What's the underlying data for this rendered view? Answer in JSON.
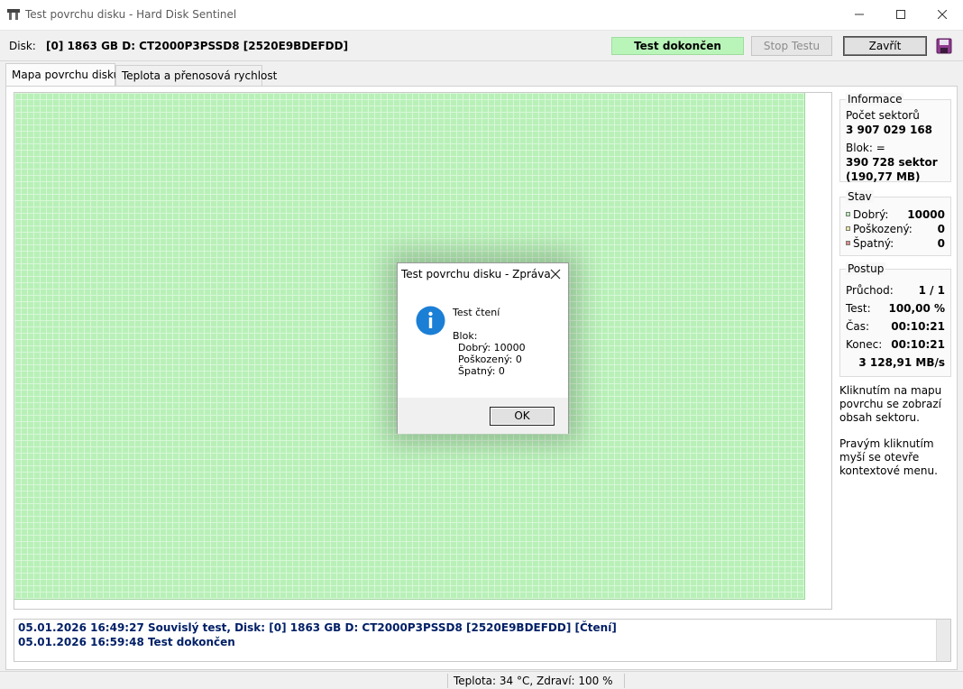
{
  "window": {
    "title": "Test povrchu disku - Hard Disk Sentinel",
    "app_icon": "disk-sentinel-icon",
    "controls": {
      "minimize": "minimize-icon",
      "maximize": "maximize-icon",
      "close": "close-icon"
    }
  },
  "toolbar": {
    "disk_label": "Disk:",
    "disk_value": "[0] 1863 GB D: CT2000P3PSSD8 [2520E9BDEFDD]",
    "status": "Test dokončen",
    "stop_label": "Stop Testu",
    "close_label": "Zavřít",
    "save_icon": "save-icon"
  },
  "tabs": [
    {
      "label": "Mapa povrchu disku",
      "active": true
    },
    {
      "label": "Teplota a přenosová rychlost",
      "active": false
    }
  ],
  "colors": {
    "good": "#b8f0b8",
    "damaged": "#f0e6a0",
    "bad": "#e08a8a",
    "status_ok": "#b9f5b9",
    "log_text": "#001f66"
  },
  "info": {
    "legend": "Informace",
    "sectors_label": "Počet sektorů",
    "sectors_value": "3 907 029 168",
    "block_label": "Blok: =",
    "block_value": "390 728 sektor",
    "block_size": "(190,77 MB)"
  },
  "stav": {
    "legend": "Stav",
    "items": [
      {
        "label": "Dobrý:",
        "value": "10000"
      },
      {
        "label": "Poškozený:",
        "value": "0"
      },
      {
        "label": "Špatný:",
        "value": "0"
      }
    ]
  },
  "postup": {
    "legend": "Postup",
    "items": [
      {
        "label": "Průchod:",
        "value": "1 / 1"
      },
      {
        "label": "Test:",
        "value": "100,00 %"
      },
      {
        "label": "Čas:",
        "value": "00:10:21"
      },
      {
        "label": "Konec:",
        "value": "00:10:21"
      }
    ],
    "speed": "3 128,91 MB/s"
  },
  "notes": {
    "p1": "Kliknutím na mapu povrchu se zobrazí obsah sektoru.",
    "p2": "Pravým kliknutím myší se otevře kontextové menu."
  },
  "log": [
    "05.01.2026  16:49:27   Souvislý test, Disk: [0] 1863 GB D: CT2000P3PSSD8 [2520E9BDEFDD] [Čtení]",
    "05.01.2026  16:59:48   Test dokončen"
  ],
  "statusbar": {
    "text": "Teplota: 34  °C,  Zdraví: 100 %"
  },
  "dialog": {
    "title": "Test povrchu disku - Zpráva",
    "icon": "info-icon",
    "line1": "Test čtení",
    "line2": "Blok:",
    "line3": "Dobrý: 10000",
    "line4": "Poškozený: 0",
    "line5": "Špatný: 0",
    "ok_label": "OK"
  }
}
